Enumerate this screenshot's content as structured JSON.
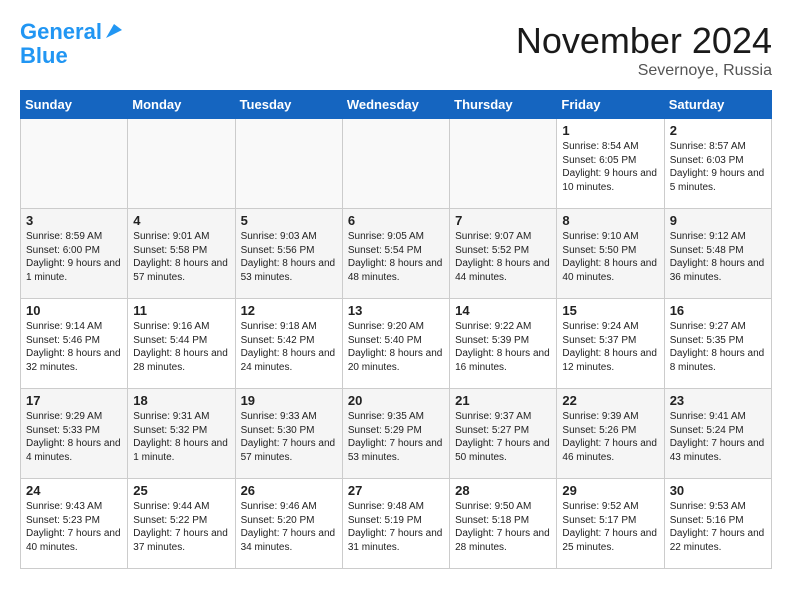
{
  "header": {
    "logo_line1": "General",
    "logo_line2": "Blue",
    "month": "November 2024",
    "location": "Severnoye, Russia"
  },
  "days_of_week": [
    "Sunday",
    "Monday",
    "Tuesday",
    "Wednesday",
    "Thursday",
    "Friday",
    "Saturday"
  ],
  "weeks": [
    [
      {
        "day": "",
        "info": ""
      },
      {
        "day": "",
        "info": ""
      },
      {
        "day": "",
        "info": ""
      },
      {
        "day": "",
        "info": ""
      },
      {
        "day": "",
        "info": ""
      },
      {
        "day": "1",
        "info": "Sunrise: 8:54 AM\nSunset: 6:05 PM\nDaylight: 9 hours and 10 minutes."
      },
      {
        "day": "2",
        "info": "Sunrise: 8:57 AM\nSunset: 6:03 PM\nDaylight: 9 hours and 5 minutes."
      }
    ],
    [
      {
        "day": "3",
        "info": "Sunrise: 8:59 AM\nSunset: 6:00 PM\nDaylight: 9 hours and 1 minute."
      },
      {
        "day": "4",
        "info": "Sunrise: 9:01 AM\nSunset: 5:58 PM\nDaylight: 8 hours and 57 minutes."
      },
      {
        "day": "5",
        "info": "Sunrise: 9:03 AM\nSunset: 5:56 PM\nDaylight: 8 hours and 53 minutes."
      },
      {
        "day": "6",
        "info": "Sunrise: 9:05 AM\nSunset: 5:54 PM\nDaylight: 8 hours and 48 minutes."
      },
      {
        "day": "7",
        "info": "Sunrise: 9:07 AM\nSunset: 5:52 PM\nDaylight: 8 hours and 44 minutes."
      },
      {
        "day": "8",
        "info": "Sunrise: 9:10 AM\nSunset: 5:50 PM\nDaylight: 8 hours and 40 minutes."
      },
      {
        "day": "9",
        "info": "Sunrise: 9:12 AM\nSunset: 5:48 PM\nDaylight: 8 hours and 36 minutes."
      }
    ],
    [
      {
        "day": "10",
        "info": "Sunrise: 9:14 AM\nSunset: 5:46 PM\nDaylight: 8 hours and 32 minutes."
      },
      {
        "day": "11",
        "info": "Sunrise: 9:16 AM\nSunset: 5:44 PM\nDaylight: 8 hours and 28 minutes."
      },
      {
        "day": "12",
        "info": "Sunrise: 9:18 AM\nSunset: 5:42 PM\nDaylight: 8 hours and 24 minutes."
      },
      {
        "day": "13",
        "info": "Sunrise: 9:20 AM\nSunset: 5:40 PM\nDaylight: 8 hours and 20 minutes."
      },
      {
        "day": "14",
        "info": "Sunrise: 9:22 AM\nSunset: 5:39 PM\nDaylight: 8 hours and 16 minutes."
      },
      {
        "day": "15",
        "info": "Sunrise: 9:24 AM\nSunset: 5:37 PM\nDaylight: 8 hours and 12 minutes."
      },
      {
        "day": "16",
        "info": "Sunrise: 9:27 AM\nSunset: 5:35 PM\nDaylight: 8 hours and 8 minutes."
      }
    ],
    [
      {
        "day": "17",
        "info": "Sunrise: 9:29 AM\nSunset: 5:33 PM\nDaylight: 8 hours and 4 minutes."
      },
      {
        "day": "18",
        "info": "Sunrise: 9:31 AM\nSunset: 5:32 PM\nDaylight: 8 hours and 1 minute."
      },
      {
        "day": "19",
        "info": "Sunrise: 9:33 AM\nSunset: 5:30 PM\nDaylight: 7 hours and 57 minutes."
      },
      {
        "day": "20",
        "info": "Sunrise: 9:35 AM\nSunset: 5:29 PM\nDaylight: 7 hours and 53 minutes."
      },
      {
        "day": "21",
        "info": "Sunrise: 9:37 AM\nSunset: 5:27 PM\nDaylight: 7 hours and 50 minutes."
      },
      {
        "day": "22",
        "info": "Sunrise: 9:39 AM\nSunset: 5:26 PM\nDaylight: 7 hours and 46 minutes."
      },
      {
        "day": "23",
        "info": "Sunrise: 9:41 AM\nSunset: 5:24 PM\nDaylight: 7 hours and 43 minutes."
      }
    ],
    [
      {
        "day": "24",
        "info": "Sunrise: 9:43 AM\nSunset: 5:23 PM\nDaylight: 7 hours and 40 minutes."
      },
      {
        "day": "25",
        "info": "Sunrise: 9:44 AM\nSunset: 5:22 PM\nDaylight: 7 hours and 37 minutes."
      },
      {
        "day": "26",
        "info": "Sunrise: 9:46 AM\nSunset: 5:20 PM\nDaylight: 7 hours and 34 minutes."
      },
      {
        "day": "27",
        "info": "Sunrise: 9:48 AM\nSunset: 5:19 PM\nDaylight: 7 hours and 31 minutes."
      },
      {
        "day": "28",
        "info": "Sunrise: 9:50 AM\nSunset: 5:18 PM\nDaylight: 7 hours and 28 minutes."
      },
      {
        "day": "29",
        "info": "Sunrise: 9:52 AM\nSunset: 5:17 PM\nDaylight: 7 hours and 25 minutes."
      },
      {
        "day": "30",
        "info": "Sunrise: 9:53 AM\nSunset: 5:16 PM\nDaylight: 7 hours and 22 minutes."
      }
    ]
  ]
}
